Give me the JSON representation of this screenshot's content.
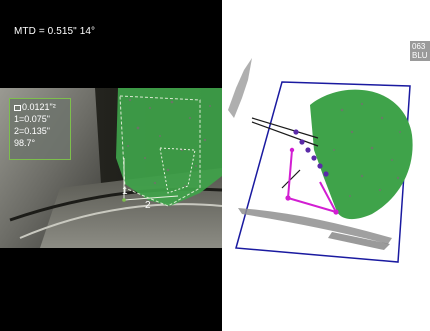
{
  "left_pane": {
    "mtd_label": "MTD = 0.515\" 14°",
    "measurement": {
      "area_value": "0.0121\"²",
      "line1": "1=0.075\"",
      "line2": "2=0.135\"",
      "percent": "98.7°"
    },
    "markers": {
      "marker1": "1",
      "marker2": "2"
    }
  },
  "right_pane": {
    "corner_tag": {
      "line1": "063",
      "line2": "BLU"
    }
  },
  "colors": {
    "measurement_green": "#3fa34a",
    "box_blue": "#1a1aa0",
    "cursor_magenta": "#d21ed2",
    "point_purple": "#5a2aa8",
    "readout_border": "#7dbf4c"
  }
}
